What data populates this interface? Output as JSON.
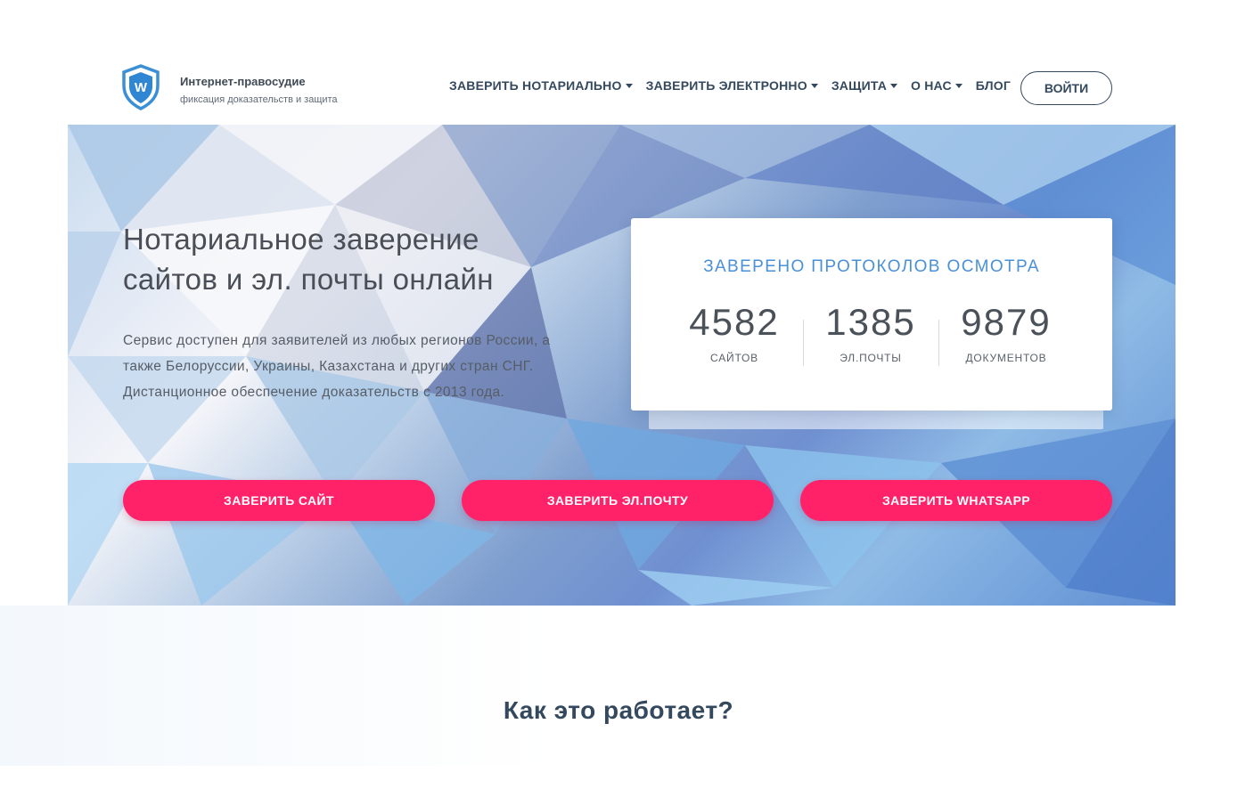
{
  "brand": {
    "name": "Интернет-правосудие",
    "tagline": "фиксация доказательств и защита",
    "logo_letter": "W",
    "logo_icon": "shield-icon"
  },
  "nav": {
    "items": [
      {
        "label": "ЗАВЕРИТЬ НОТАРИАЛЬНО",
        "dropdown": true
      },
      {
        "label": "ЗАВЕРИТЬ ЭЛЕКТРОННО",
        "dropdown": true
      },
      {
        "label": "ЗАЩИТА",
        "dropdown": true
      },
      {
        "label": "О НАС",
        "dropdown": true
      },
      {
        "label": "БЛОГ",
        "dropdown": false
      }
    ],
    "login_label": "ВОЙТИ"
  },
  "hero": {
    "title_line1": "Нотариальное заверение",
    "title_line2": "сайтов и эл. почты онлайн",
    "desc_line1": "Сервис доступен для заявителей из любых регионов России, а",
    "desc_line2": "также Белоруссии, Украины, Казахстана и других стран СНГ.",
    "desc_line3": "Дистанционное обеспечение доказательств с 2013 года."
  },
  "stats": {
    "title": "ЗАВЕРЕНО ПРОТОКОЛОВ ОСМОТРА",
    "items": [
      {
        "value": "4582",
        "label": "САЙТОВ"
      },
      {
        "value": "1385",
        "label": "ЭЛ.ПОЧТЫ"
      },
      {
        "value": "9879",
        "label": "ДОКУМЕНТОВ"
      }
    ]
  },
  "cta": {
    "site": "ЗАВЕРИТЬ САЙТ",
    "email": "ЗАВЕРИТЬ ЭЛ.ПОЧТУ",
    "whatsapp": "ЗАВЕРИТЬ WHATSAPP"
  },
  "how": {
    "title": "Как это работает?"
  },
  "colors": {
    "accent": "#ff2268",
    "stats_title": "#4a90d9",
    "nav_text": "#34495e"
  }
}
